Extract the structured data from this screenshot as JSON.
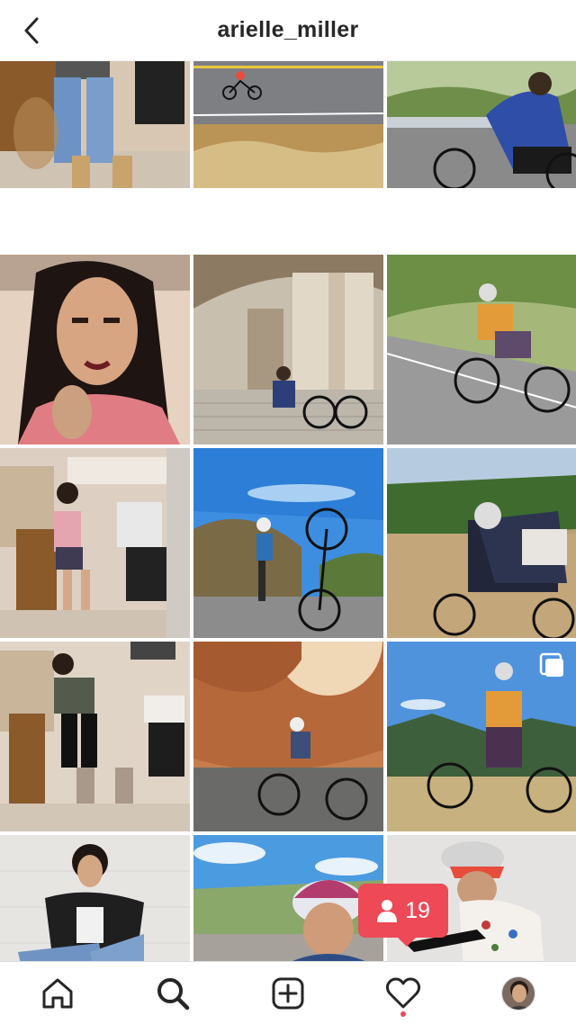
{
  "header": {
    "title": "arielle_miller",
    "back_icon": "chevron-left-icon"
  },
  "grid": {
    "posts": [
      {
        "desc": "woman in jeans and boots in room"
      },
      {
        "desc": "cyclist on road with dry grass"
      },
      {
        "desc": "cyclist in blue jersey by guardrail"
      },
      {
        "desc": "selfie woman pink top"
      },
      {
        "desc": "woman with bike on building steps"
      },
      {
        "desc": "cyclist in orange jersey on road"
      },
      {
        "desc": "mirror selfie in room"
      },
      {
        "desc": "woman holding bike wheelie blue sky"
      },
      {
        "desc": "cyclist with white helmet orchard"
      },
      {
        "desc": "mirror selfie black outfit"
      },
      {
        "desc": "cyclist in canyon sunlight"
      },
      {
        "desc": "woman standing with bike mountains",
        "multi": true
      },
      {
        "desc": "woman in leather jacket crouching"
      },
      {
        "desc": "smiling cyclist with helmet"
      },
      {
        "desc": "cyclist white jersey with bike"
      }
    ],
    "multi_icon": "multiple-photos-icon"
  },
  "notification": {
    "count": "19",
    "icon": "person-icon",
    "color": "#ed4956"
  },
  "tabbar": {
    "items": [
      {
        "name": "home-icon"
      },
      {
        "name": "search-icon",
        "active": true
      },
      {
        "name": "new-post-icon"
      },
      {
        "name": "heart-icon",
        "has_dot": true
      },
      {
        "name": "profile-avatar"
      }
    ]
  }
}
